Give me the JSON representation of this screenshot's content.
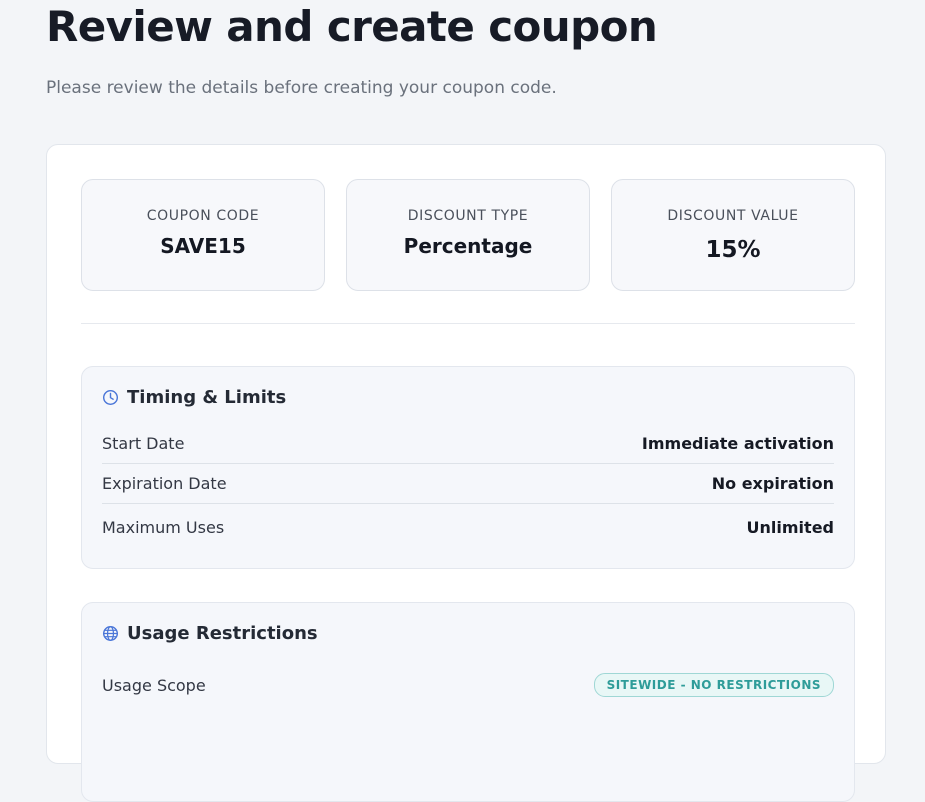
{
  "header": {
    "title": "Review and create coupon",
    "subtitle": "Please review the details before creating your coupon code."
  },
  "summary": [
    {
      "label": "COUPON CODE",
      "value": "SAVE15"
    },
    {
      "label": "DISCOUNT TYPE",
      "value": "Percentage"
    },
    {
      "label": "DISCOUNT VALUE",
      "value": "15%"
    }
  ],
  "timing": {
    "title": "Timing & Limits",
    "icon": "clock-icon",
    "rows": [
      {
        "label": "Start Date",
        "value": "Immediate activation"
      },
      {
        "label": "Expiration Date",
        "value": "No expiration"
      },
      {
        "label": "Maximum Uses",
        "value": "Unlimited"
      }
    ]
  },
  "usage": {
    "title": "Usage Restrictions",
    "icon": "globe-icon",
    "rows": [
      {
        "label": "Usage Scope",
        "value": "SITEWIDE - NO RESTRICTIONS"
      }
    ]
  },
  "colors": {
    "accent_blue": "#4a76d8",
    "badge_teal": "#2e9c99",
    "badge_bg": "#e8f7f6"
  }
}
